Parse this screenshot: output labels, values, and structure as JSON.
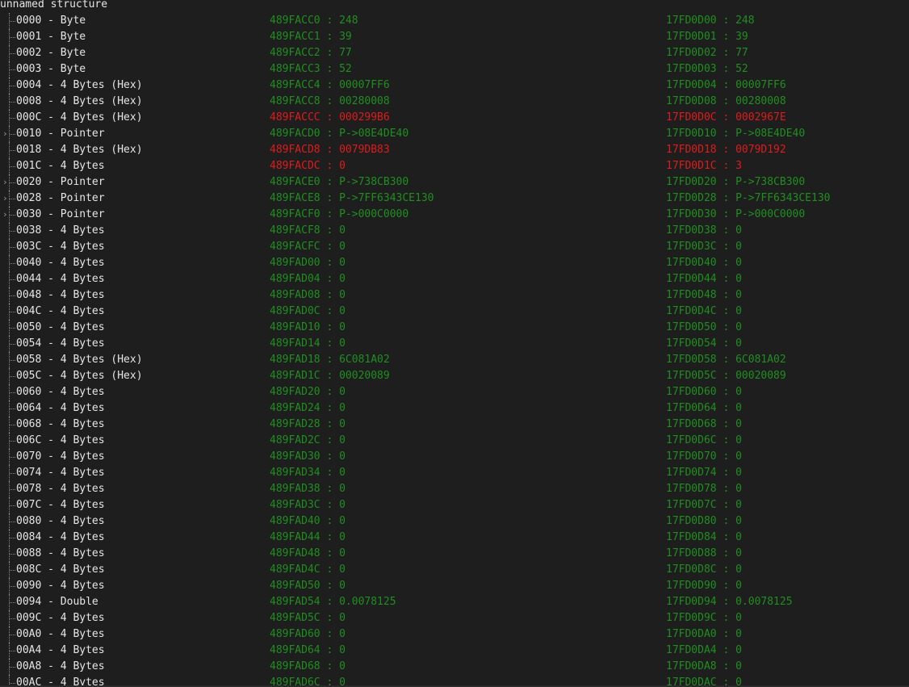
{
  "title": "unnamed structure",
  "rows": [
    {
      "field": "0000 - Byte",
      "a": "489FACC0 : 248",
      "b": "17FD0D00 : 248",
      "changed": false,
      "expandable": false
    },
    {
      "field": "0001 - Byte",
      "a": "489FACC1 : 39",
      "b": "17FD0D01 : 39",
      "changed": false,
      "expandable": false
    },
    {
      "field": "0002 - Byte",
      "a": "489FACC2 : 77",
      "b": "17FD0D02 : 77",
      "changed": false,
      "expandable": false
    },
    {
      "field": "0003 - Byte",
      "a": "489FACC3 : 52",
      "b": "17FD0D03 : 52",
      "changed": false,
      "expandable": false
    },
    {
      "field": "0004 - 4 Bytes (Hex)",
      "a": "489FACC4 : 00007FF6",
      "b": "17FD0D04 : 00007FF6",
      "changed": false,
      "expandable": false
    },
    {
      "field": "0008 - 4 Bytes (Hex)",
      "a": "489FACC8 : 00280008",
      "b": "17FD0D08 : 00280008",
      "changed": false,
      "expandable": false
    },
    {
      "field": "000C - 4 Bytes (Hex)",
      "a": "489FACCC : 000299B6",
      "b": "17FD0D0C : 0002967E",
      "changed": true,
      "expandable": false
    },
    {
      "field": "0010 - Pointer",
      "a": "489FACD0 : P->08E4DE40",
      "b": "17FD0D10 : P->08E4DE40",
      "changed": false,
      "expandable": true
    },
    {
      "field": "0018 - 4 Bytes (Hex)",
      "a": "489FACD8 : 0079DB83",
      "b": "17FD0D18 : 0079D192",
      "changed": true,
      "expandable": false
    },
    {
      "field": "001C - 4 Bytes",
      "a": "489FACDC : 0",
      "b": "17FD0D1C : 3",
      "changed": true,
      "expandable": false
    },
    {
      "field": "0020 - Pointer",
      "a": "489FACE0 : P->738CB300",
      "b": "17FD0D20 : P->738CB300",
      "changed": false,
      "expandable": true
    },
    {
      "field": "0028 - Pointer",
      "a": "489FACE8 : P->7FF6343CE130",
      "b": "17FD0D28 : P->7FF6343CE130",
      "changed": false,
      "expandable": true
    },
    {
      "field": "0030 - Pointer",
      "a": "489FACF0 : P->000C0000",
      "b": "17FD0D30 : P->000C0000",
      "changed": false,
      "expandable": true
    },
    {
      "field": "0038 - 4 Bytes",
      "a": "489FACF8 : 0",
      "b": "17FD0D38 : 0",
      "changed": false,
      "expandable": false
    },
    {
      "field": "003C - 4 Bytes",
      "a": "489FACFC : 0",
      "b": "17FD0D3C : 0",
      "changed": false,
      "expandable": false
    },
    {
      "field": "0040 - 4 Bytes",
      "a": "489FAD00 : 0",
      "b": "17FD0D40 : 0",
      "changed": false,
      "expandable": false
    },
    {
      "field": "0044 - 4 Bytes",
      "a": "489FAD04 : 0",
      "b": "17FD0D44 : 0",
      "changed": false,
      "expandable": false
    },
    {
      "field": "0048 - 4 Bytes",
      "a": "489FAD08 : 0",
      "b": "17FD0D48 : 0",
      "changed": false,
      "expandable": false
    },
    {
      "field": "004C - 4 Bytes",
      "a": "489FAD0C : 0",
      "b": "17FD0D4C : 0",
      "changed": false,
      "expandable": false
    },
    {
      "field": "0050 - 4 Bytes",
      "a": "489FAD10 : 0",
      "b": "17FD0D50 : 0",
      "changed": false,
      "expandable": false
    },
    {
      "field": "0054 - 4 Bytes",
      "a": "489FAD14 : 0",
      "b": "17FD0D54 : 0",
      "changed": false,
      "expandable": false
    },
    {
      "field": "0058 - 4 Bytes (Hex)",
      "a": "489FAD18 : 6C081A02",
      "b": "17FD0D58 : 6C081A02",
      "changed": false,
      "expandable": false
    },
    {
      "field": "005C - 4 Bytes (Hex)",
      "a": "489FAD1C : 00020089",
      "b": "17FD0D5C : 00020089",
      "changed": false,
      "expandable": false
    },
    {
      "field": "0060 - 4 Bytes",
      "a": "489FAD20 : 0",
      "b": "17FD0D60 : 0",
      "changed": false,
      "expandable": false
    },
    {
      "field": "0064 - 4 Bytes",
      "a": "489FAD24 : 0",
      "b": "17FD0D64 : 0",
      "changed": false,
      "expandable": false
    },
    {
      "field": "0068 - 4 Bytes",
      "a": "489FAD28 : 0",
      "b": "17FD0D68 : 0",
      "changed": false,
      "expandable": false
    },
    {
      "field": "006C - 4 Bytes",
      "a": "489FAD2C : 0",
      "b": "17FD0D6C : 0",
      "changed": false,
      "expandable": false
    },
    {
      "field": "0070 - 4 Bytes",
      "a": "489FAD30 : 0",
      "b": "17FD0D70 : 0",
      "changed": false,
      "expandable": false
    },
    {
      "field": "0074 - 4 Bytes",
      "a": "489FAD34 : 0",
      "b": "17FD0D74 : 0",
      "changed": false,
      "expandable": false
    },
    {
      "field": "0078 - 4 Bytes",
      "a": "489FAD38 : 0",
      "b": "17FD0D78 : 0",
      "changed": false,
      "expandable": false
    },
    {
      "field": "007C - 4 Bytes",
      "a": "489FAD3C : 0",
      "b": "17FD0D7C : 0",
      "changed": false,
      "expandable": false
    },
    {
      "field": "0080 - 4 Bytes",
      "a": "489FAD40 : 0",
      "b": "17FD0D80 : 0",
      "changed": false,
      "expandable": false
    },
    {
      "field": "0084 - 4 Bytes",
      "a": "489FAD44 : 0",
      "b": "17FD0D84 : 0",
      "changed": false,
      "expandable": false
    },
    {
      "field": "0088 - 4 Bytes",
      "a": "489FAD48 : 0",
      "b": "17FD0D88 : 0",
      "changed": false,
      "expandable": false
    },
    {
      "field": "008C - 4 Bytes",
      "a": "489FAD4C : 0",
      "b": "17FD0D8C : 0",
      "changed": false,
      "expandable": false
    },
    {
      "field": "0090 - 4 Bytes",
      "a": "489FAD50 : 0",
      "b": "17FD0D90 : 0",
      "changed": false,
      "expandable": false
    },
    {
      "field": "0094 - Double",
      "a": "489FAD54 : 0.0078125",
      "b": "17FD0D94 : 0.0078125",
      "changed": false,
      "expandable": false
    },
    {
      "field": "009C - 4 Bytes",
      "a": "489FAD5C : 0",
      "b": "17FD0D9C : 0",
      "changed": false,
      "expandable": false
    },
    {
      "field": "00A0 - 4 Bytes",
      "a": "489FAD60 : 0",
      "b": "17FD0DA0 : 0",
      "changed": false,
      "expandable": false
    },
    {
      "field": "00A4 - 4 Bytes",
      "a": "489FAD64 : 0",
      "b": "17FD0DA4 : 0",
      "changed": false,
      "expandable": false
    },
    {
      "field": "00A8 - 4 Bytes",
      "a": "489FAD68 : 0",
      "b": "17FD0DA8 : 0",
      "changed": false,
      "expandable": false
    },
    {
      "field": "00AC - 4 Bytes",
      "a": "489FAD6C : 0",
      "b": "17FD0DAC : 0",
      "changed": false,
      "expandable": false
    }
  ],
  "colors": {
    "background": "#1e1e1e",
    "label": "#e6e6e6",
    "value": "#1f8f1f",
    "changed": "#e01b1b"
  },
  "icons": {
    "expander": "chevron-right-icon"
  }
}
